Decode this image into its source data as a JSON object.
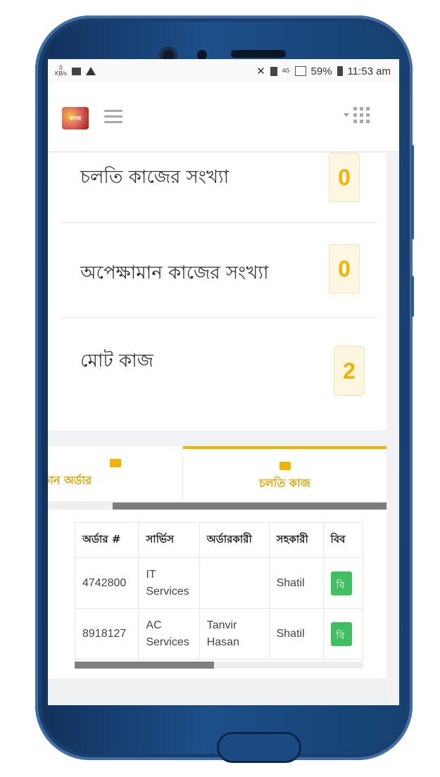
{
  "status_bar": {
    "kb_value": "0",
    "kb_unit": "KB/s",
    "lte_label": "4G",
    "battery": "59%",
    "time": "11:53 am"
  },
  "app_bar": {
    "logo_text": "কাজ",
    "menu_icon": "hamburger-icon",
    "grid_icon": "apps-grid-icon"
  },
  "stats": [
    {
      "label": "চলতি কাজের সংখ্যা",
      "value": "0"
    },
    {
      "label": "অপেক্ষামান কাজের সংখ্যা",
      "value": "0"
    },
    {
      "label": "মোট কাজ",
      "value": "2"
    }
  ],
  "tabs": [
    {
      "label": "কান অর্ডার",
      "icon": "new-order-icon",
      "active": false
    },
    {
      "label": "চলতি কাজ",
      "icon": "card-icon",
      "active": true
    }
  ],
  "tab_scroll_position": 0.19,
  "table": {
    "headers": [
      "অর্ডার #",
      "সার্ভিস",
      "অর্ডারকারী",
      "সহকারী",
      "বিব"
    ],
    "rows": [
      {
        "order": "4742800",
        "service": "IT Services",
        "customer": "",
        "assistant": "Shatil",
        "action": "বি"
      },
      {
        "order": "8918127",
        "service": "AC Services",
        "customer": "Tanvir Hasan",
        "assistant": "Shatil",
        "action": "বি"
      }
    ],
    "scroll_fraction": 0.48
  },
  "colors": {
    "accent": "#f0b400",
    "badge_bg": "#fdf7e2",
    "action_green": "#3fbf5f",
    "frame_blue": "#1d4f8a"
  }
}
